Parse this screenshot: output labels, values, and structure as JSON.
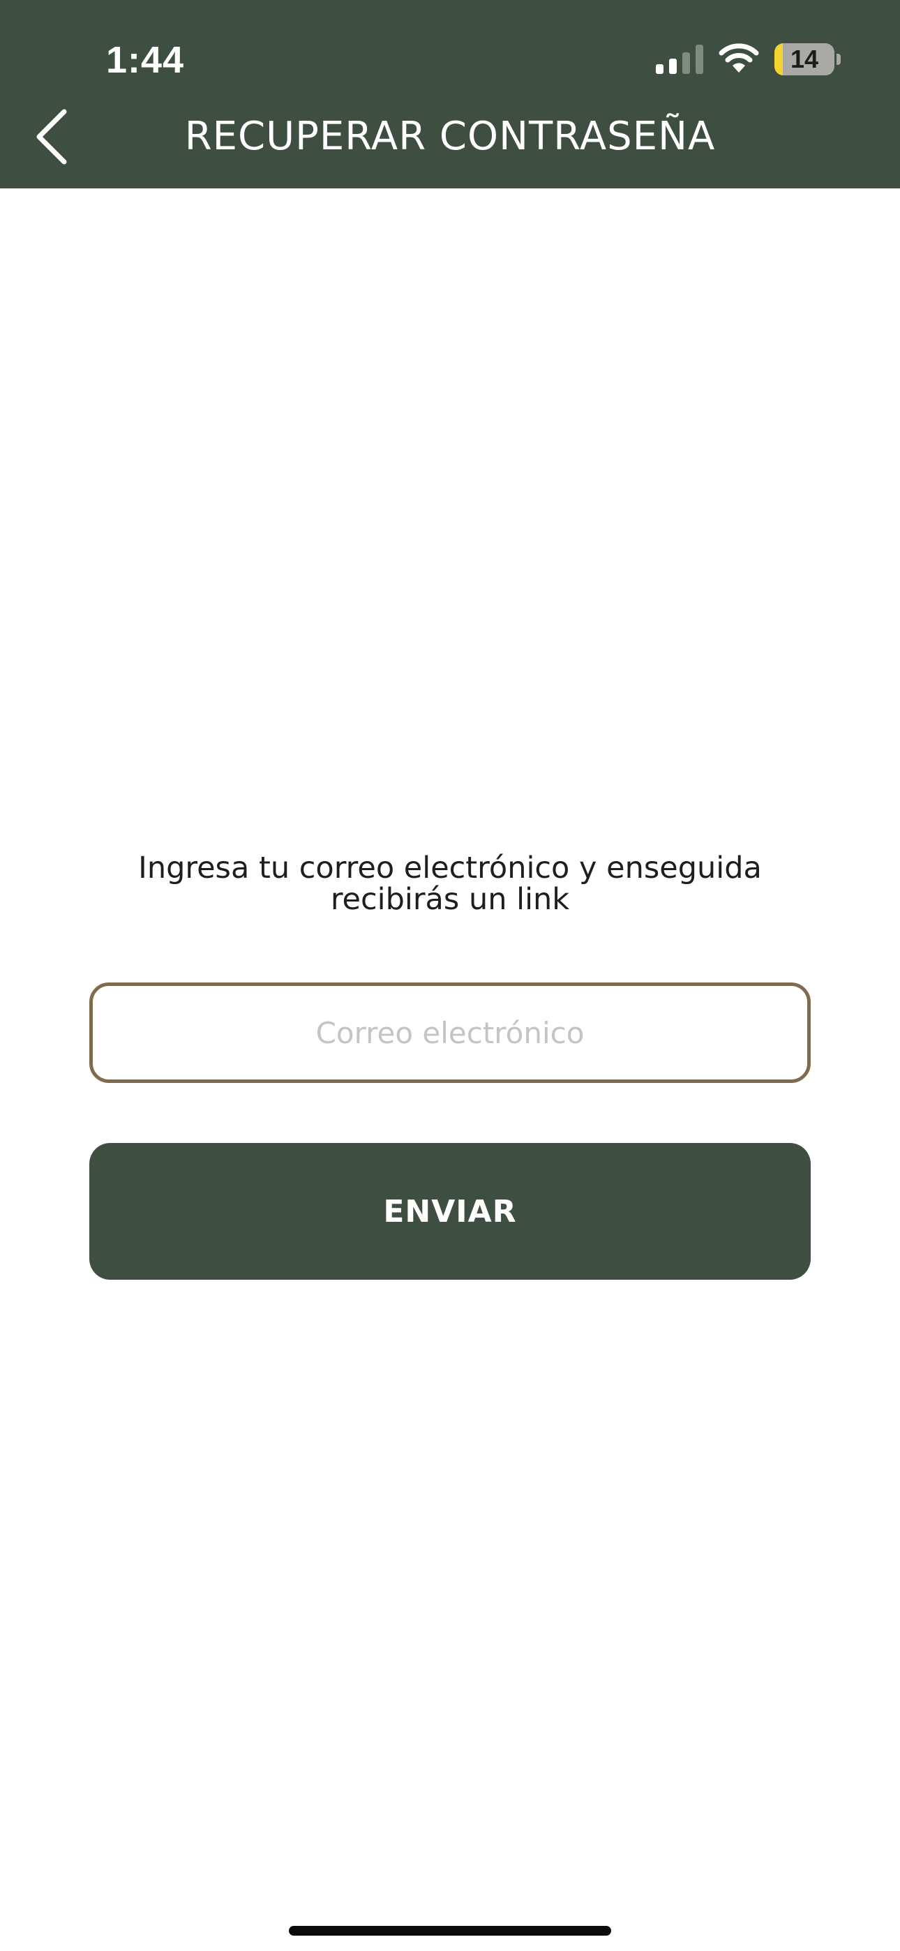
{
  "status_bar": {
    "time": "1:44",
    "battery_level": "14",
    "battery_fraction": 0.14,
    "signal_bars_active": 2,
    "signal_bars_total": 4
  },
  "header": {
    "title": "RECUPERAR CONTRASEÑA",
    "back_icon": "chevron-left-icon"
  },
  "form": {
    "instructions": "Ingresa tu correo electrónico y enseguida recibirás un link",
    "email_placeholder": "Correo electrónico",
    "email_value": "",
    "submit_label": "ENVIAR"
  },
  "colors": {
    "header_bg": "#3e4f41",
    "button_bg": "#3e4f41",
    "field_border": "#7d6c4e",
    "battery_low": "#f5d432"
  }
}
